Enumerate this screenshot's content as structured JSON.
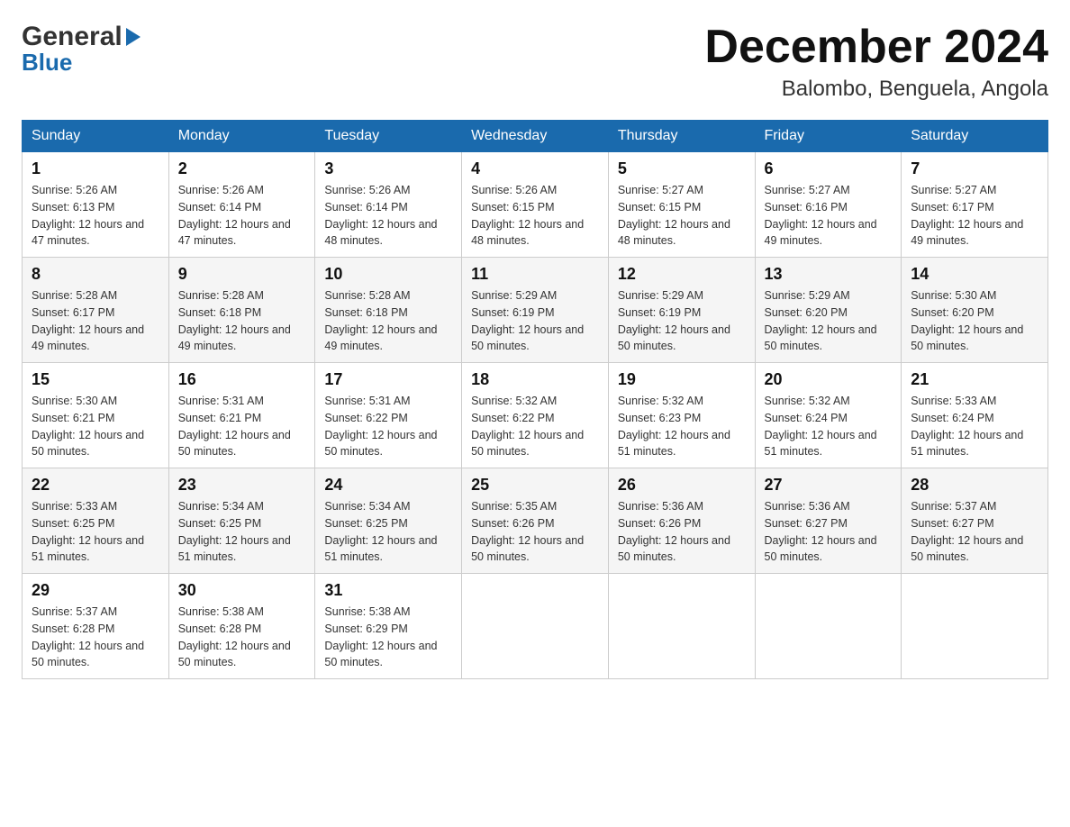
{
  "logo": {
    "line1": "General",
    "arrow": "▶",
    "line2": "Blue"
  },
  "header": {
    "month": "December 2024",
    "location": "Balombo, Benguela, Angola"
  },
  "days_of_week": [
    "Sunday",
    "Monday",
    "Tuesday",
    "Wednesday",
    "Thursday",
    "Friday",
    "Saturday"
  ],
  "weeks": [
    [
      {
        "day": "1",
        "sunrise": "5:26 AM",
        "sunset": "6:13 PM",
        "daylight": "12 hours and 47 minutes."
      },
      {
        "day": "2",
        "sunrise": "5:26 AM",
        "sunset": "6:14 PM",
        "daylight": "12 hours and 47 minutes."
      },
      {
        "day": "3",
        "sunrise": "5:26 AM",
        "sunset": "6:14 PM",
        "daylight": "12 hours and 48 minutes."
      },
      {
        "day": "4",
        "sunrise": "5:26 AM",
        "sunset": "6:15 PM",
        "daylight": "12 hours and 48 minutes."
      },
      {
        "day": "5",
        "sunrise": "5:27 AM",
        "sunset": "6:15 PM",
        "daylight": "12 hours and 48 minutes."
      },
      {
        "day": "6",
        "sunrise": "5:27 AM",
        "sunset": "6:16 PM",
        "daylight": "12 hours and 49 minutes."
      },
      {
        "day": "7",
        "sunrise": "5:27 AM",
        "sunset": "6:17 PM",
        "daylight": "12 hours and 49 minutes."
      }
    ],
    [
      {
        "day": "8",
        "sunrise": "5:28 AM",
        "sunset": "6:17 PM",
        "daylight": "12 hours and 49 minutes."
      },
      {
        "day": "9",
        "sunrise": "5:28 AM",
        "sunset": "6:18 PM",
        "daylight": "12 hours and 49 minutes."
      },
      {
        "day": "10",
        "sunrise": "5:28 AM",
        "sunset": "6:18 PM",
        "daylight": "12 hours and 49 minutes."
      },
      {
        "day": "11",
        "sunrise": "5:29 AM",
        "sunset": "6:19 PM",
        "daylight": "12 hours and 50 minutes."
      },
      {
        "day": "12",
        "sunrise": "5:29 AM",
        "sunset": "6:19 PM",
        "daylight": "12 hours and 50 minutes."
      },
      {
        "day": "13",
        "sunrise": "5:29 AM",
        "sunset": "6:20 PM",
        "daylight": "12 hours and 50 minutes."
      },
      {
        "day": "14",
        "sunrise": "5:30 AM",
        "sunset": "6:20 PM",
        "daylight": "12 hours and 50 minutes."
      }
    ],
    [
      {
        "day": "15",
        "sunrise": "5:30 AM",
        "sunset": "6:21 PM",
        "daylight": "12 hours and 50 minutes."
      },
      {
        "day": "16",
        "sunrise": "5:31 AM",
        "sunset": "6:21 PM",
        "daylight": "12 hours and 50 minutes."
      },
      {
        "day": "17",
        "sunrise": "5:31 AM",
        "sunset": "6:22 PM",
        "daylight": "12 hours and 50 minutes."
      },
      {
        "day": "18",
        "sunrise": "5:32 AM",
        "sunset": "6:22 PM",
        "daylight": "12 hours and 50 minutes."
      },
      {
        "day": "19",
        "sunrise": "5:32 AM",
        "sunset": "6:23 PM",
        "daylight": "12 hours and 51 minutes."
      },
      {
        "day": "20",
        "sunrise": "5:32 AM",
        "sunset": "6:24 PM",
        "daylight": "12 hours and 51 minutes."
      },
      {
        "day": "21",
        "sunrise": "5:33 AM",
        "sunset": "6:24 PM",
        "daylight": "12 hours and 51 minutes."
      }
    ],
    [
      {
        "day": "22",
        "sunrise": "5:33 AM",
        "sunset": "6:25 PM",
        "daylight": "12 hours and 51 minutes."
      },
      {
        "day": "23",
        "sunrise": "5:34 AM",
        "sunset": "6:25 PM",
        "daylight": "12 hours and 51 minutes."
      },
      {
        "day": "24",
        "sunrise": "5:34 AM",
        "sunset": "6:25 PM",
        "daylight": "12 hours and 51 minutes."
      },
      {
        "day": "25",
        "sunrise": "5:35 AM",
        "sunset": "6:26 PM",
        "daylight": "12 hours and 50 minutes."
      },
      {
        "day": "26",
        "sunrise": "5:36 AM",
        "sunset": "6:26 PM",
        "daylight": "12 hours and 50 minutes."
      },
      {
        "day": "27",
        "sunrise": "5:36 AM",
        "sunset": "6:27 PM",
        "daylight": "12 hours and 50 minutes."
      },
      {
        "day": "28",
        "sunrise": "5:37 AM",
        "sunset": "6:27 PM",
        "daylight": "12 hours and 50 minutes."
      }
    ],
    [
      {
        "day": "29",
        "sunrise": "5:37 AM",
        "sunset": "6:28 PM",
        "daylight": "12 hours and 50 minutes."
      },
      {
        "day": "30",
        "sunrise": "5:38 AM",
        "sunset": "6:28 PM",
        "daylight": "12 hours and 50 minutes."
      },
      {
        "day": "31",
        "sunrise": "5:38 AM",
        "sunset": "6:29 PM",
        "daylight": "12 hours and 50 minutes."
      },
      null,
      null,
      null,
      null
    ]
  ]
}
